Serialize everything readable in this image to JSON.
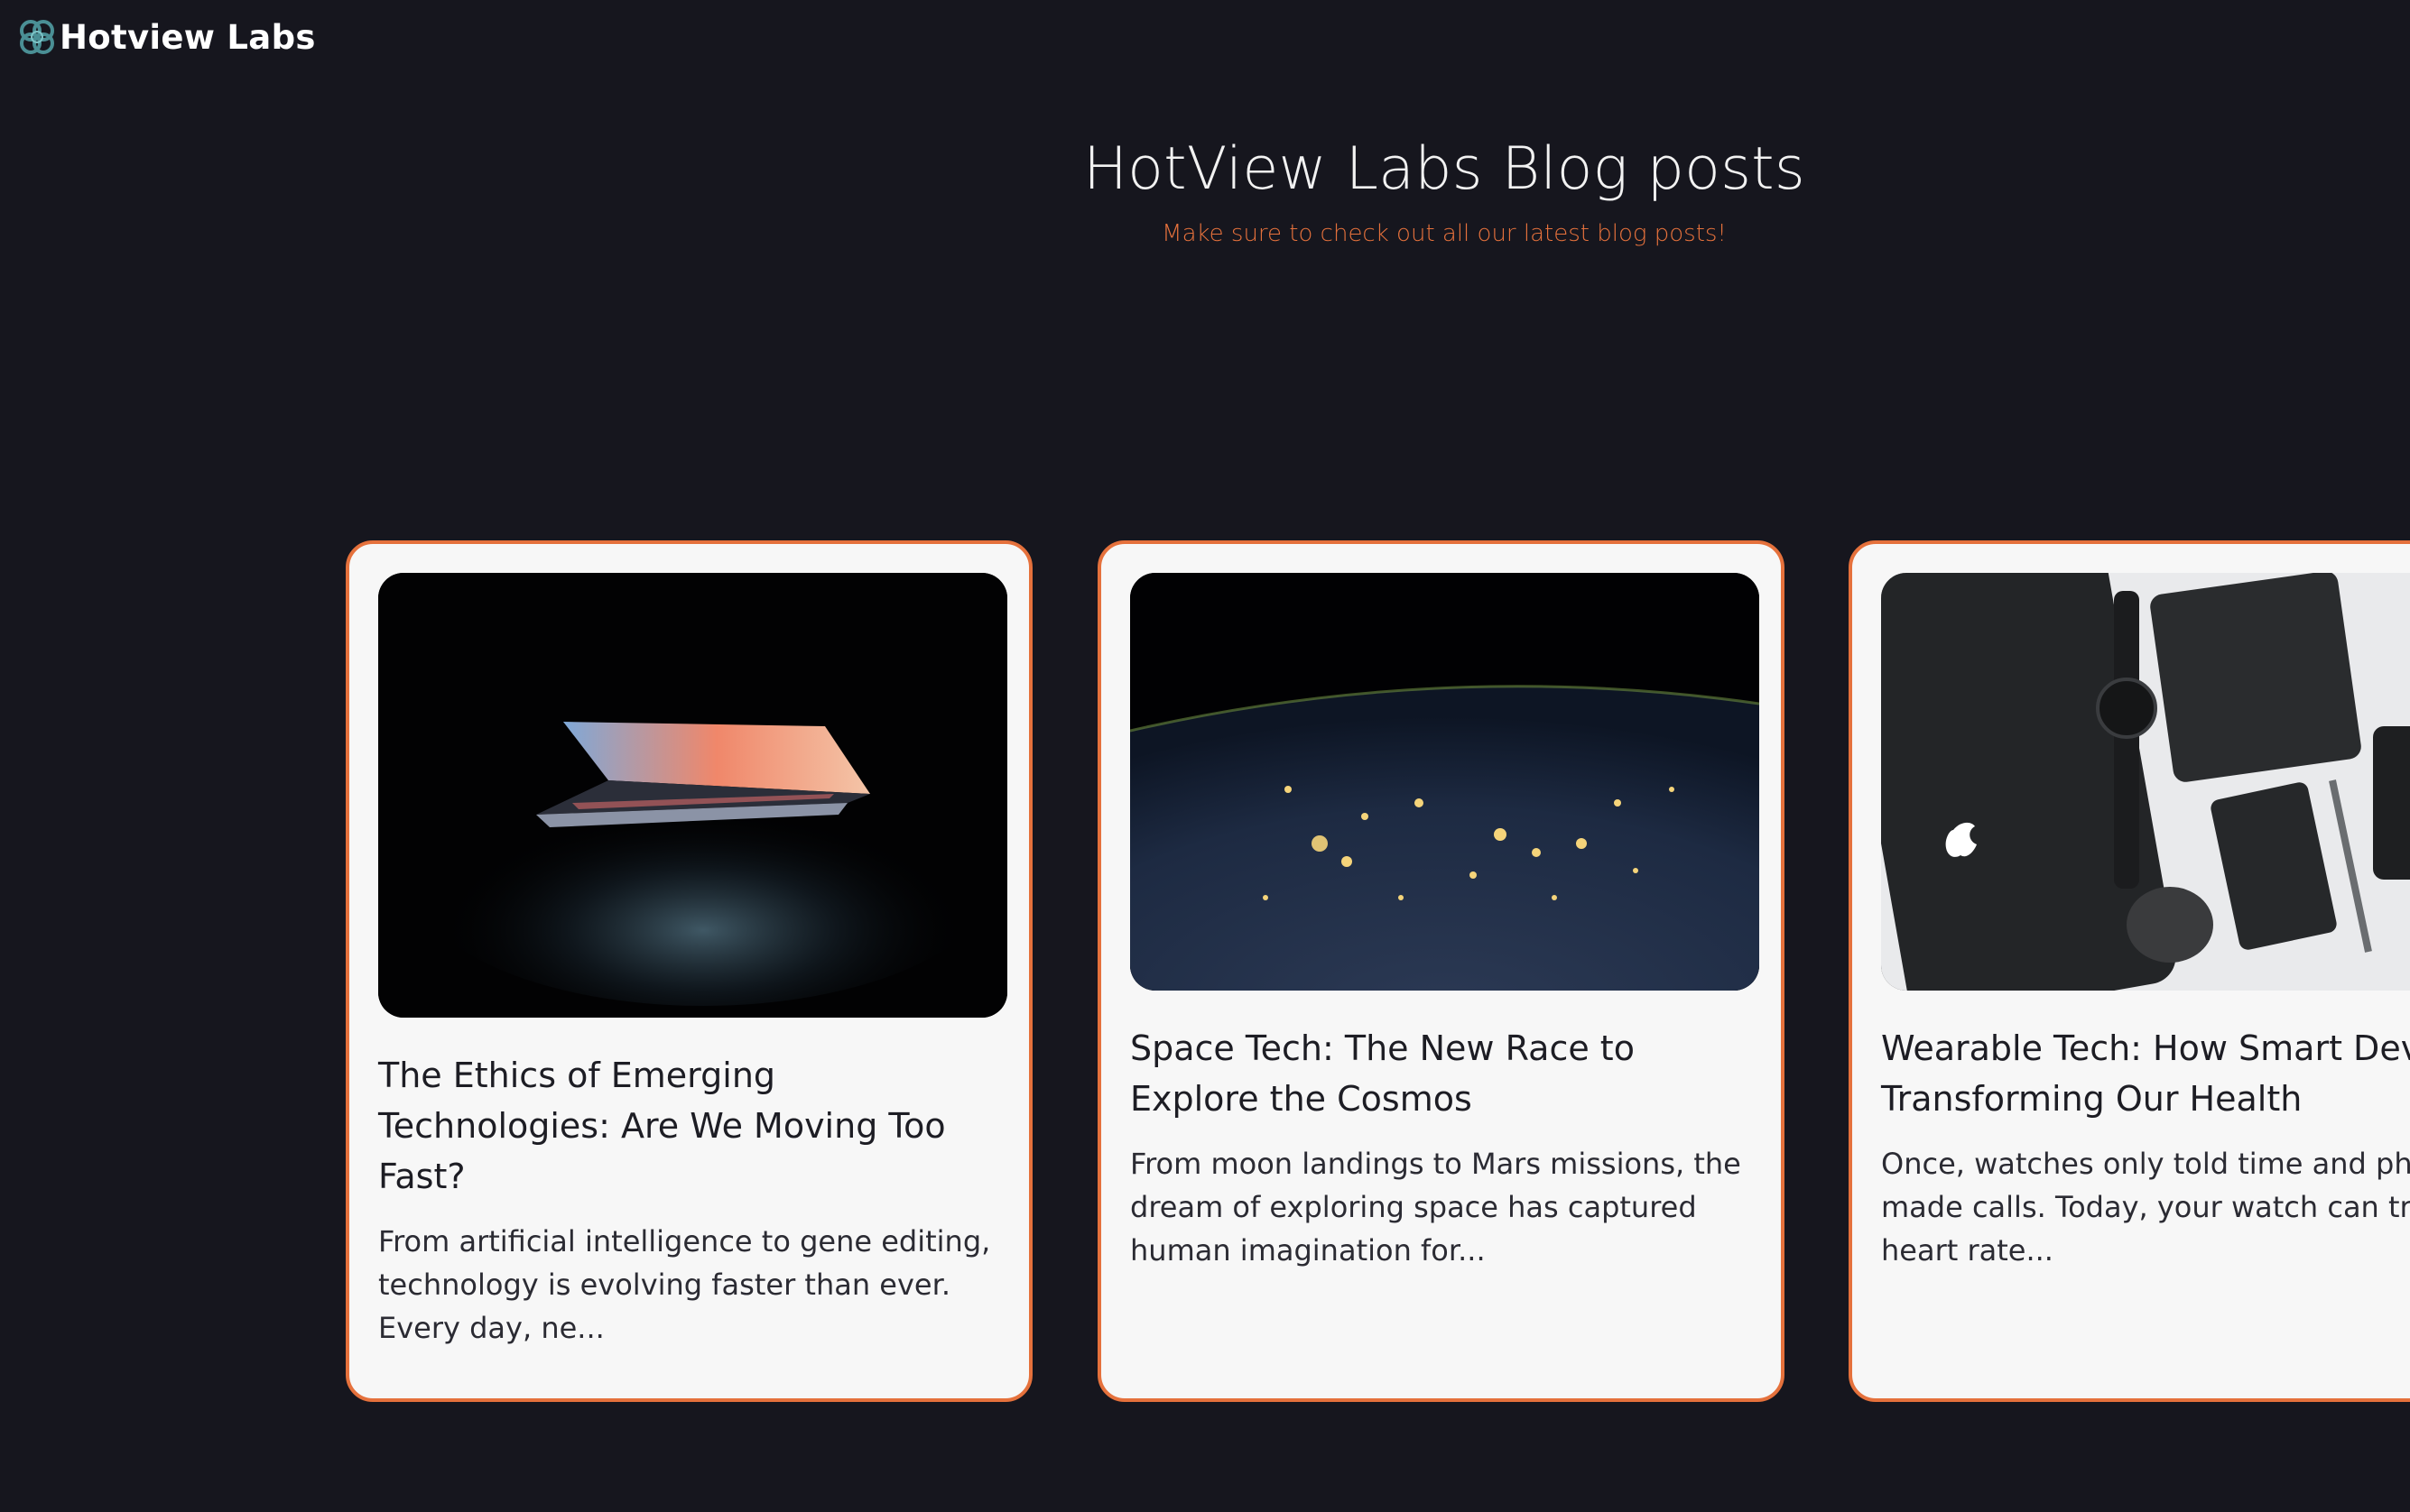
{
  "brand": {
    "name": "Hotview Labs",
    "logo_icon": "knot-logo-icon",
    "accent_color": "#e5713c",
    "background_color": "#16161e"
  },
  "hero": {
    "title": "HotView Labs Blog posts",
    "subtitle": "Make sure to check out all our latest blog posts!"
  },
  "posts": [
    {
      "title": "The Ethics of Emerging Technologies: Are We Moving Too Fast?",
      "excerpt": "From artificial intelligence to gene editing, technology is evolving faster than ever. Every day, ne...",
      "image": "laptop-in-dark-image"
    },
    {
      "title": "Space Tech: The New Race to Explore the Cosmos",
      "excerpt": "From moon landings to Mars missions, the dream of exploring space has captured human imagination for...",
      "image": "earth-at-night-image"
    },
    {
      "title": "Wearable Tech: How Smart Devices Are Transforming Our Health",
      "excerpt": "Once, watches only told time and phones only made calls. Today, your watch can track your heart rate...",
      "image": "gadgets-flatlay-image"
    }
  ]
}
